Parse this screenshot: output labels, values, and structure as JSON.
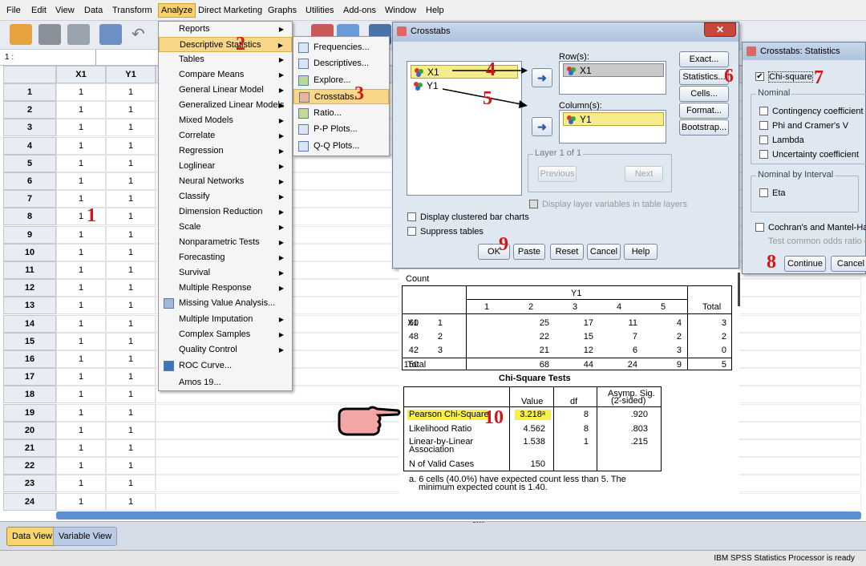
{
  "menubar": [
    "File",
    "Edit",
    "View",
    "Data",
    "Transform",
    "Analyze",
    "Direct Marketing",
    "Graphs",
    "Utilities",
    "Add-ons",
    "Window",
    "Help"
  ],
  "cell_ref": "1 :",
  "grid": {
    "columns": [
      "X1",
      "Y1"
    ],
    "rows": [
      "1",
      "2",
      "3",
      "4",
      "5",
      "6",
      "7",
      "8",
      "9",
      "10",
      "11",
      "12",
      "13",
      "14",
      "15",
      "16",
      "17",
      "18",
      "19",
      "20",
      "21",
      "22",
      "23",
      "24"
    ],
    "value": "1"
  },
  "analyze_menu": [
    "Reports",
    "Descriptive Statistics",
    "Tables",
    "Compare Means",
    "General Linear Model",
    "Generalized Linear Models",
    "Mixed Models",
    "Correlate",
    "Regression",
    "Loglinear",
    "Neural Networks",
    "Classify",
    "Dimension Reduction",
    "Scale",
    "Nonparametric Tests",
    "Forecasting",
    "Survival",
    "Multiple Response",
    "Missing Value Analysis...",
    "Multiple Imputation",
    "Complex Samples",
    "Quality Control",
    "ROC Curve...",
    "Amos 19..."
  ],
  "desc_menu": [
    "Frequencies...",
    "Descriptives...",
    "Explore...",
    "Crosstabs...",
    "Ratio...",
    "P-P Plots...",
    "Q-Q Plots..."
  ],
  "crosstabs": {
    "title": "Crosstabs",
    "vars": [
      "X1",
      "Y1"
    ],
    "row_label": "Row(s):",
    "row_var": "X1",
    "col_label": "Column(s):",
    "col_var": "Y1",
    "layer": "Layer 1 of 1",
    "previous": "Previous",
    "next": "Next",
    "display_layer": "Display layer variables in table layers",
    "clustered": "Display clustered bar charts",
    "suppress": "Suppress tables",
    "side_buttons": [
      "Exact...",
      "Statistics...",
      "Cells...",
      "Format...",
      "Bootstrap..."
    ],
    "bottom_buttons": [
      "OK",
      "Paste",
      "Reset",
      "Cancel",
      "Help"
    ]
  },
  "stats_dlg": {
    "title": "Crosstabs: Statistics",
    "chi": "Chi-square",
    "nominal": "Nominal",
    "nominal_items": [
      "Contingency coefficient",
      "Phi and Cramer's V",
      "Lambda",
      "Uncertainty coefficient"
    ],
    "interval": "Nominal by Interval",
    "eta": "Eta",
    "cochran": "Cochran's and Mantel-Hae",
    "test_odds": "Test common odds ratio e",
    "continue": "Continue",
    "cancel": "Cancel"
  },
  "count_table": {
    "caption": "Count",
    "y_label": "Y1",
    "headers": [
      "1",
      "2",
      "3",
      "4",
      "5",
      "Total"
    ],
    "x_label": "X1",
    "rows": [
      [
        "1",
        "25",
        "17",
        "11",
        "4",
        "3",
        "60"
      ],
      [
        "2",
        "22",
        "15",
        "7",
        "2",
        "2",
        "48"
      ],
      [
        "3",
        "21",
        "12",
        "6",
        "3",
        "0",
        "42"
      ]
    ],
    "total_label": "Total",
    "totals": [
      "68",
      "44",
      "24",
      "9",
      "5",
      "150"
    ]
  },
  "chi_table": {
    "title": "Chi-Square Tests",
    "headers": [
      "Value",
      "df",
      "Asymp. Sig.",
      "(2-sided)"
    ],
    "rows": [
      [
        "Pearson Chi-Square",
        "3.218ᵃ",
        "8",
        ".920"
      ],
      [
        "Likelihood Ratio",
        "4.562",
        "8",
        ".803"
      ],
      [
        "Linear-by-Linear",
        "1.538",
        "1",
        ".215"
      ],
      [
        "N of Valid Cases",
        "150",
        "",
        ""
      ]
    ],
    "assoc": "Association",
    "footnote1": "a. 6 cells (40.0%) have expected count less than 5. The",
    "footnote2": "minimum expected count is 1.40."
  },
  "markers": [
    "1",
    "2",
    "3",
    "4",
    "5",
    "6",
    "7",
    "8",
    "9",
    "10"
  ],
  "tabs": [
    "Data View",
    "Variable View"
  ],
  "status": "IBM SPSS Statistics Processor is ready",
  "colors": {
    "highlight": "#f8d78a",
    "marker": "#d01818"
  }
}
